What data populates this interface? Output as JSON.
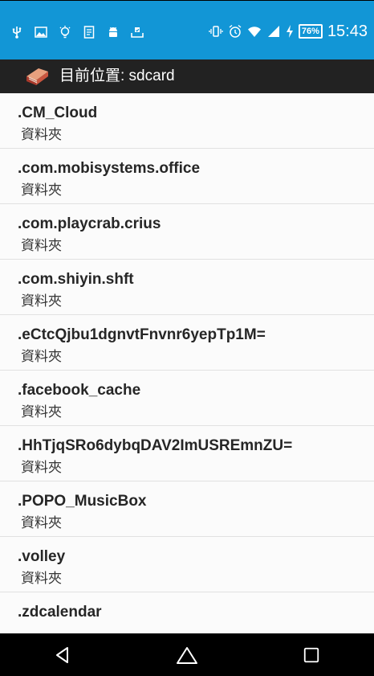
{
  "status_bar": {
    "battery": "76%",
    "time": "15:43",
    "icons": [
      "usb-icon",
      "image-icon",
      "lightbulb-icon",
      "document-icon",
      "android-icon",
      "upload-icon",
      "vibrate-icon",
      "alarm-icon",
      "wifi-icon",
      "signal-icon",
      "charging-icon"
    ]
  },
  "app_bar": {
    "title": "目前位置: sdcard"
  },
  "files": [
    {
      "name": ".CM_Cloud",
      "type": "資料夾"
    },
    {
      "name": ".com.mobisystems.office",
      "type": "資料夾"
    },
    {
      "name": ".com.playcrab.crius",
      "type": "資料夾"
    },
    {
      "name": ".com.shiyin.shft",
      "type": "資料夾"
    },
    {
      "name": ".eCtcQjbu1dgnvtFnvnr6yepTp1M=",
      "type": "資料夾"
    },
    {
      "name": ".facebook_cache",
      "type": "資料夾"
    },
    {
      "name": ".HhTjqSRo6dybqDAV2ImUSREmnZU=",
      "type": "資料夾"
    },
    {
      "name": ".POPO_MusicBox",
      "type": "資料夾"
    },
    {
      "name": ".volley",
      "type": "資料夾"
    },
    {
      "name": ".zdcalendar",
      "type": ""
    }
  ],
  "colors": {
    "status_bar": "#1296d6",
    "app_bar": "#222222",
    "nav_bar": "#000000"
  }
}
